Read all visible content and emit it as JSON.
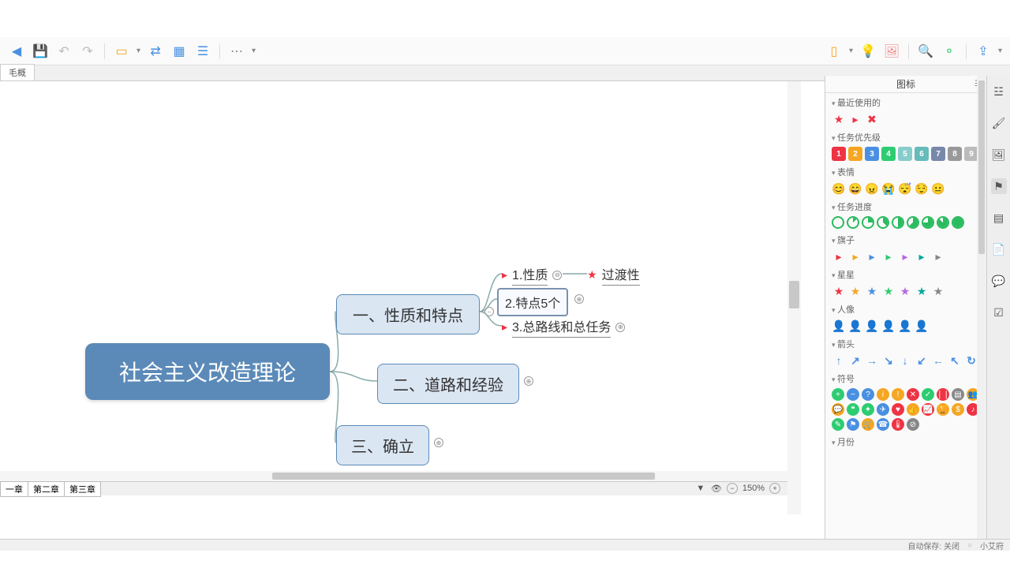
{
  "toolbar": {
    "icons_left": [
      "back-icon",
      "save-icon",
      "undo-icon",
      "redo-icon",
      "sep",
      "theme-icon",
      "dd",
      "structure-icon",
      "drill-icon",
      "outline-icon",
      "sep",
      "more-icon",
      "dd"
    ],
    "icons_right": [
      "present-icon",
      "dd",
      "idea-icon",
      "image-icon",
      "sep",
      "search-icon",
      "share-icon",
      "sep",
      "export-icon",
      "dd"
    ]
  },
  "tabs": {
    "main": "毛概"
  },
  "mindmap": {
    "root": "社会主义改造理论",
    "b1": {
      "label": "一、性质和特点",
      "s1": {
        "flag": "▸",
        "flag_color": "#e34",
        "label": "1.性质",
        "exp": "⊖",
        "leaf": {
          "star": "★",
          "star_color": "#e34",
          "label": "过渡性"
        }
      },
      "s2": {
        "label": "2.特点5个",
        "exp": "⊕"
      },
      "s3": {
        "flag": "▸",
        "flag_color": "#e34",
        "label": "3.总路线和总任务",
        "exp": "⊕"
      }
    },
    "b2": {
      "label": "二、道路和经验",
      "exp": "⊕"
    },
    "b3": {
      "label": "三、确立",
      "exp": "⊕"
    }
  },
  "chart_data": {
    "type": "mindmap",
    "root": "社会主义改造理论",
    "children": [
      {
        "label": "一、性质和特点",
        "children": [
          {
            "label": "1.性质",
            "marker": "flag-red",
            "expanded": true,
            "children": [
              {
                "label": "过渡性",
                "marker": "star-red"
              }
            ]
          },
          {
            "label": "2.特点5个",
            "expanded": false,
            "selected": true
          },
          {
            "label": "3.总路线和总任务",
            "marker": "flag-red",
            "expanded": false
          }
        ]
      },
      {
        "label": "二、道路和经验",
        "expanded": false
      },
      {
        "label": "三、确立",
        "expanded": false
      }
    ]
  },
  "sheets": [
    "一章",
    "第二章",
    "第三章"
  ],
  "canvas_status": {
    "zoom": "150%"
  },
  "panel": {
    "title": "图标",
    "sections": {
      "recent": {
        "label": "最近使用的"
      },
      "priority": {
        "label": "任务优先级"
      },
      "emotion": {
        "label": "表情"
      },
      "progress": {
        "label": "任务进度"
      },
      "flags": {
        "label": "旗子"
      },
      "stars": {
        "label": "星星"
      },
      "people": {
        "label": "人像"
      },
      "arrows": {
        "label": "箭头"
      },
      "symbols": {
        "label": "符号"
      },
      "months": {
        "label": "月份"
      }
    },
    "priority_colors": [
      "#e34",
      "#f5a623",
      "#4a90e2",
      "#2ecc71",
      "#8cc",
      "#6bb",
      "#78a",
      "#999",
      "#bbb"
    ],
    "emotions": [
      "😊",
      "😄",
      "😠",
      "😭",
      "😴",
      "😌",
      "😐"
    ],
    "flag_colors": [
      "#e34",
      "#f5a623",
      "#4a90e2",
      "#2ecc71",
      "#b668e0",
      "#00a99d",
      "#888"
    ],
    "star_colors": [
      "#e34",
      "#f5a623",
      "#4a90e2",
      "#2ecc71",
      "#b668e0",
      "#00a99d",
      "#888"
    ],
    "people_colors": [
      "#e34",
      "#f5a623",
      "#4a90e2",
      "#2ecc71",
      "#b668e0",
      "#888"
    ],
    "arrow_glyphs": [
      "↑",
      "↗",
      "→",
      "↘",
      "↓",
      "↙",
      "←",
      "↖",
      "↻"
    ],
    "symbol_rows": [
      [
        {
          "g": "+",
          "c": "#2ecc71"
        },
        {
          "g": "−",
          "c": "#4a90e2"
        },
        {
          "g": "?",
          "c": "#4a90e2"
        },
        {
          "g": "i",
          "c": "#f5a623"
        },
        {
          "g": "!",
          "c": "#f5a623"
        },
        {
          "g": "✕",
          "c": "#e34"
        },
        {
          "g": "✓",
          "c": "#2ecc71"
        },
        {
          "g": "❘❘",
          "c": "#e34"
        }
      ],
      [
        {
          "g": "▤",
          "c": "#888"
        },
        {
          "g": "👥",
          "c": "#f5a623"
        },
        {
          "g": "💬",
          "c": "#f5a623"
        },
        {
          "g": "❝",
          "c": "#2ecc71"
        },
        {
          "g": "✦",
          "c": "#2ecc71"
        },
        {
          "g": "✈",
          "c": "#4a90e2"
        },
        {
          "g": "♥",
          "c": "#e34"
        },
        {
          "g": "👍",
          "c": "#f5a623"
        }
      ],
      [
        {
          "g": "📈",
          "c": "#e34"
        },
        {
          "g": "🏆",
          "c": "#f5a623"
        },
        {
          "g": "$",
          "c": "#f5a623"
        },
        {
          "g": "♪",
          "c": "#e34"
        },
        {
          "g": "✎",
          "c": "#2ecc71"
        },
        {
          "g": "⚑",
          "c": "#4a90e2"
        },
        {
          "g": "🛒",
          "c": "#f5a623"
        },
        {
          "g": "☎",
          "c": "#4a90e2"
        }
      ],
      [
        {
          "g": "🌡",
          "c": "#e34"
        },
        {
          "g": "⊘",
          "c": "#888"
        }
      ]
    ]
  },
  "statusbar": {
    "autosave": "自动保存: 关闭",
    "user": "小艾府"
  }
}
